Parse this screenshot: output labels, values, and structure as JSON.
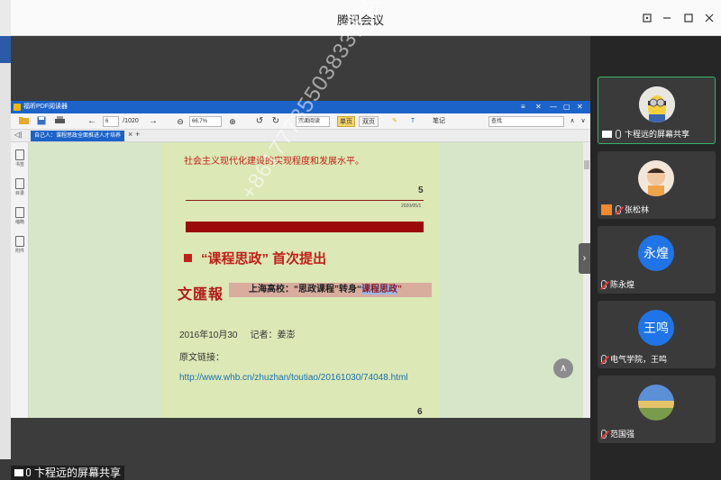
{
  "window": {
    "title": "腾讯会议"
  },
  "share": {
    "sharer_label": "卞程远的屏幕共享",
    "pdf": {
      "app_title": "福昕PDF阅读器",
      "page_current": "6",
      "page_total": "/1020",
      "zoom": "66.7%",
      "view_mode": "双面阅读",
      "search_placeholder": "查找",
      "tab_label": "自己人：课程思政全面推进人才培养",
      "toolbar_texts": {
        "btn_a": "单页",
        "btn_b": "双页",
        "btn_c": "笔记"
      },
      "side_tools": [
        "书签",
        "目录",
        "缩略",
        "附件"
      ],
      "page": {
        "line1": "社会主义现代化建设的实现程度和发展水平。",
        "page_number_top": "5",
        "date_small": "2020/05/1",
        "heading": "“课程思政” 首次提出",
        "paper_logo": "文匯報",
        "banner_prefix": "上海高校：“思政课程”转身“",
        "banner_highlight": "课程思政",
        "banner_suffix": "”",
        "meta_date": "2016年10月30",
        "meta_reporter": "记者：姜澎",
        "original_link_label": "原文链接：",
        "link": "http://www.whb.cn/zhuzhan/toutiao/20161030/74048.html",
        "page_number_bottom": "6"
      }
    },
    "watermark": "+86177735503833张松林"
  },
  "participants": [
    {
      "name": "卞程远的屏幕共享",
      "avatar": "minion",
      "mic": "on",
      "active": true,
      "screen_share": true
    },
    {
      "name": "张松林",
      "avatar": "child-photo",
      "mic": "off",
      "active": false
    },
    {
      "name": "陈永煌",
      "avatar_text": "永煌",
      "mic": "off",
      "active": false
    },
    {
      "name": "电气学院，王鸣",
      "avatar_text": "王鸣",
      "mic": "off",
      "active": false
    },
    {
      "name": "范国强",
      "avatar": "landscape-photo",
      "mic": "off",
      "active": false
    }
  ],
  "colors": {
    "accent": "#1f74e6",
    "active_border": "#35b56b",
    "pdf_blue": "#1c63c9",
    "headline_red": "#c0201a"
  }
}
